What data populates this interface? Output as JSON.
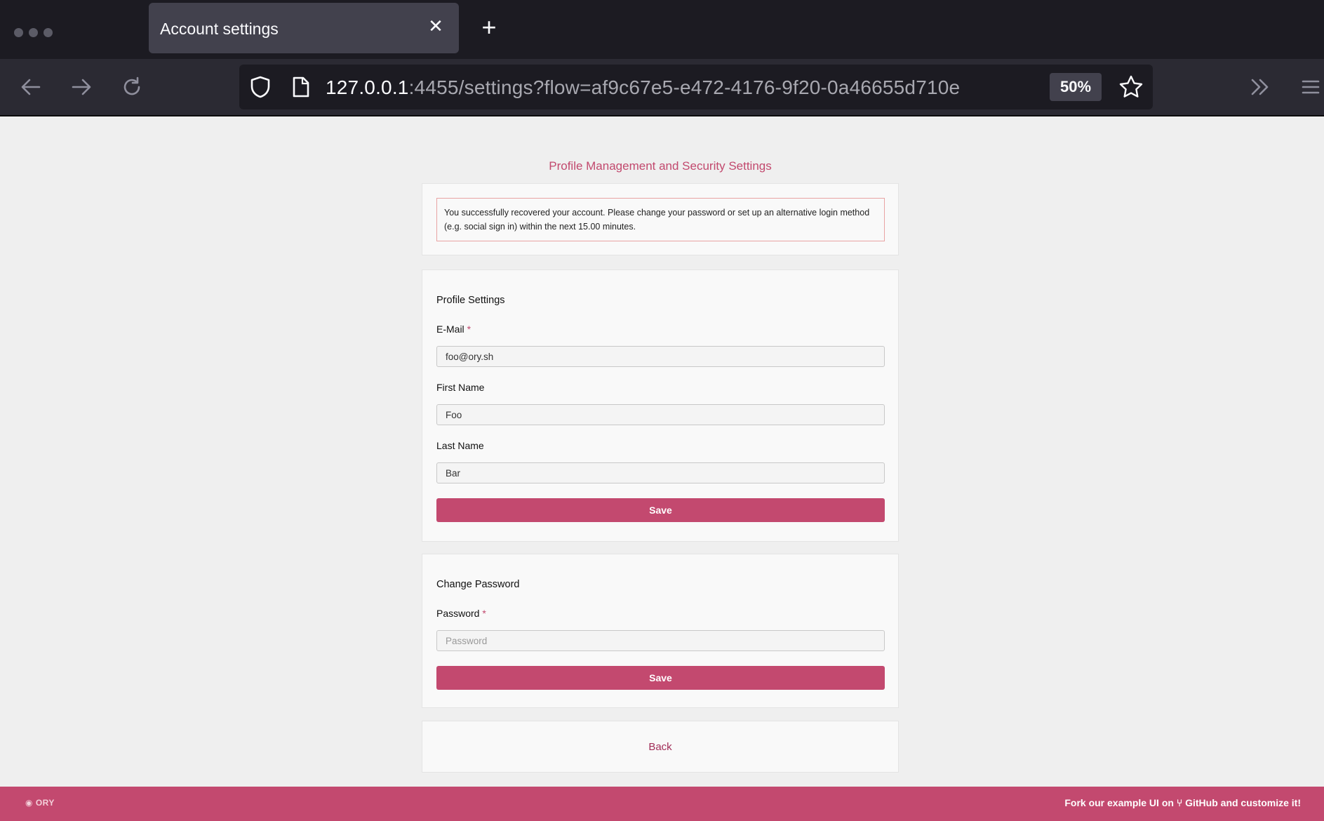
{
  "browser": {
    "tab_title": "Account settings",
    "url_host": "127.0.0.1",
    "url_rest": ":4455/settings?flow=af9c67e5-e472-4176-9f20-0a46655d710e",
    "zoom": "50%"
  },
  "page": {
    "title": "Profile Management and Security Settings",
    "alert_text": "You successfully recovered your account. Please change your password or set up an alternative login method (e.g. social sign in) within the next 15.00 minutes."
  },
  "profile": {
    "section_title": "Profile Settings",
    "email_label": "E-Mail",
    "email_value": "foo@ory.sh",
    "first_name_label": "First Name",
    "first_name_value": "Foo",
    "last_name_label": "Last Name",
    "last_name_value": "Bar",
    "save_label": "Save"
  },
  "password": {
    "section_title": "Change Password",
    "label": "Password",
    "placeholder": "Password",
    "save_label": "Save"
  },
  "back_label": "Back",
  "footer": {
    "logo_text": "ORY",
    "fork_text": "Fork our example UI on ⑂ GitHub and customize it!"
  },
  "colors": {
    "accent": "#c3496f",
    "link": "#a12e58"
  }
}
